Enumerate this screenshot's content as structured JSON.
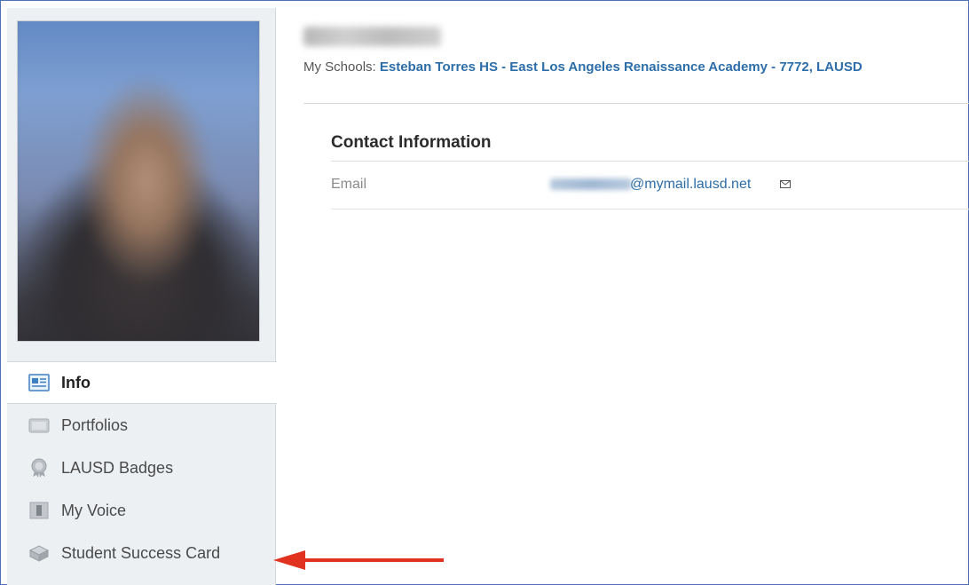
{
  "profile": {
    "schools_label": "My Schools:",
    "schools_link": "Esteban Torres HS - East Los Angeles Renaissance Academy - 7772",
    "schools_more": ", LAUSD"
  },
  "contact": {
    "title": "Contact Information",
    "email_label": "Email",
    "email_domain": "@mymail.lausd.net"
  },
  "sidebar": {
    "items": [
      {
        "label": "Info",
        "icon": "info-card-icon",
        "active": true
      },
      {
        "label": "Portfolios",
        "icon": "portfolio-icon"
      },
      {
        "label": "LAUSD Badges",
        "icon": "badge-icon"
      },
      {
        "label": "My Voice",
        "icon": "voice-icon"
      },
      {
        "label": "Student Success Card",
        "icon": "success-card-icon"
      }
    ]
  },
  "colors": {
    "link": "#2d6ea8",
    "sidebar_bg": "#edf0f3",
    "arrow": "#e0321f"
  }
}
